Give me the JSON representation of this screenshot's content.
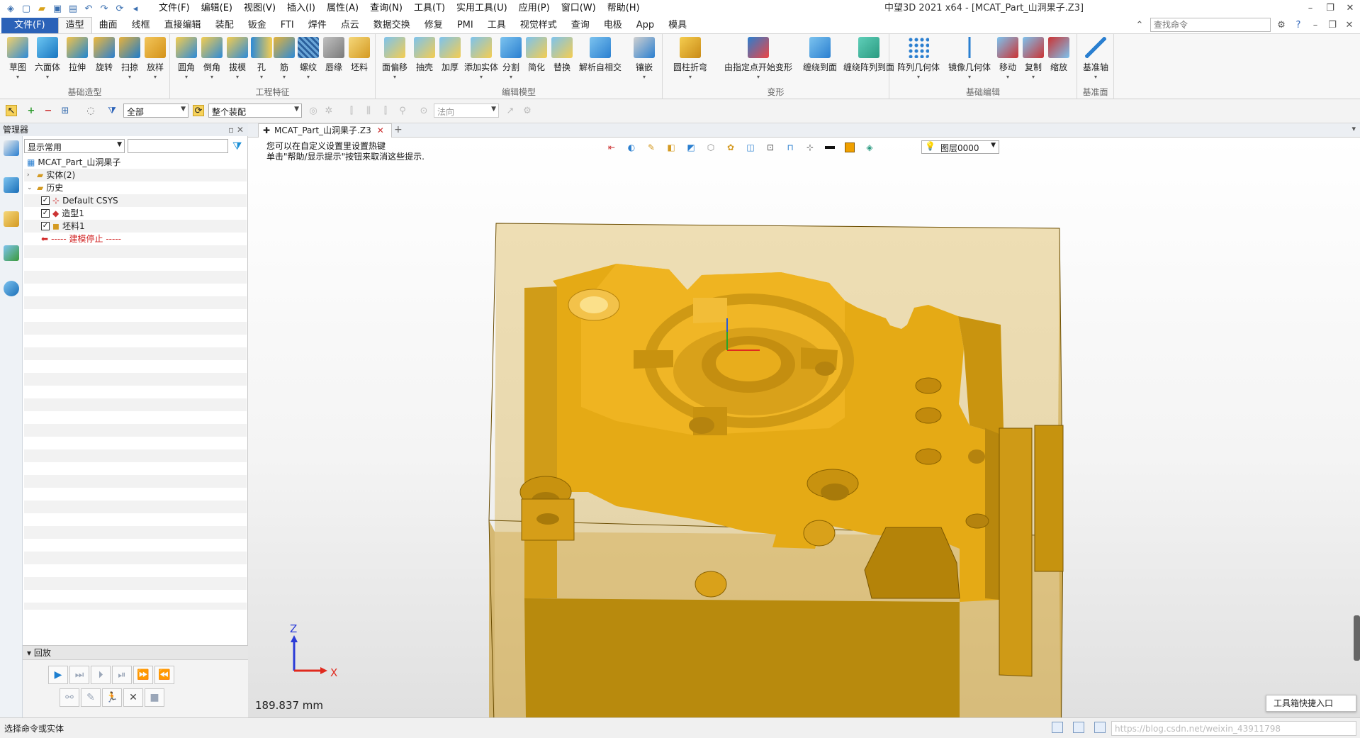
{
  "titlebar": {
    "menus": [
      "文件(F)",
      "编辑(E)",
      "视图(V)",
      "插入(I)",
      "属性(A)",
      "查询(N)",
      "工具(T)",
      "实用工具(U)",
      "应用(P)",
      "窗口(W)",
      "帮助(H)"
    ],
    "title": "中望3D 2021 x64 - [MCAT_Part_山洞果子.Z3]"
  },
  "ribbon_tabs": [
    "文件(F)",
    "造型",
    "曲面",
    "线框",
    "直接编辑",
    "装配",
    "钣金",
    "FTI",
    "焊件",
    "点云",
    "数据交换",
    "修复",
    "PMI",
    "工具",
    "视觉样式",
    "查询",
    "电极",
    "App",
    "模具"
  ],
  "active_tab": "造型",
  "command_search_placeholder": "查找命令",
  "ribbon_groups": [
    {
      "label": "基础造型",
      "buttons": [
        "草图",
        "六面体",
        "拉伸",
        "旋转",
        "扫掠",
        "放样"
      ]
    },
    {
      "label": "工程特征",
      "buttons": [
        "圆角",
        "倒角",
        "拔模",
        "孔",
        "筋",
        "螺纹",
        "唇缘",
        "坯料"
      ]
    },
    {
      "label": "编辑模型",
      "buttons": [
        "面偏移",
        "抽壳",
        "加厚",
        "添加实体",
        "分割",
        "简化",
        "替换",
        "解析自相交",
        "镶嵌"
      ]
    },
    {
      "label": "变形",
      "buttons": [
        "圆柱折弯",
        "由指定点开始变形",
        "缠绕到面",
        "缠绕阵列到面"
      ]
    },
    {
      "label": "基础编辑",
      "buttons": [
        "阵列几何体",
        "镜像几何体",
        "移动",
        "复制",
        "缩放"
      ]
    },
    {
      "label": "基准面",
      "buttons": [
        "基准轴"
      ]
    }
  ],
  "toolbar": {
    "filter_value": "全部",
    "assembly_value": "整个装配",
    "direction_value": "法向"
  },
  "manager": {
    "title": "管理器",
    "display_filter": "显示常用",
    "tree": [
      {
        "label": "MCAT_Part_山洞果子",
        "level": 0
      },
      {
        "label": "实体(2)",
        "level": 1
      },
      {
        "label": "历史",
        "level": 1
      },
      {
        "label": "Default CSYS",
        "level": 2
      },
      {
        "label": "造型1",
        "level": 2
      },
      {
        "label": "坯料1",
        "level": 2
      },
      {
        "label": "----- 建模停止 -----",
        "level": 2
      }
    ],
    "playback_title": "回放"
  },
  "document": {
    "tab_label": "MCAT_Part_山洞果子.Z3",
    "hint_line1": "您可以在自定义设置里设置热键",
    "hint_line2": "单击\"帮助/显示提示\"按钮来取消这些提示.",
    "layer": "图层0000",
    "measurement": "189.837 mm",
    "toolbox_entry": "工具箱快捷入口",
    "axis_labels": {
      "x": "X",
      "z": "Z"
    }
  },
  "status": {
    "message": "选择命令或实体",
    "watermark": "https://blog.csdn.net/weixin_43911798"
  },
  "colors": {
    "model": "#e0a419",
    "model_dark": "#b88310",
    "accent": "#2b62b8"
  }
}
